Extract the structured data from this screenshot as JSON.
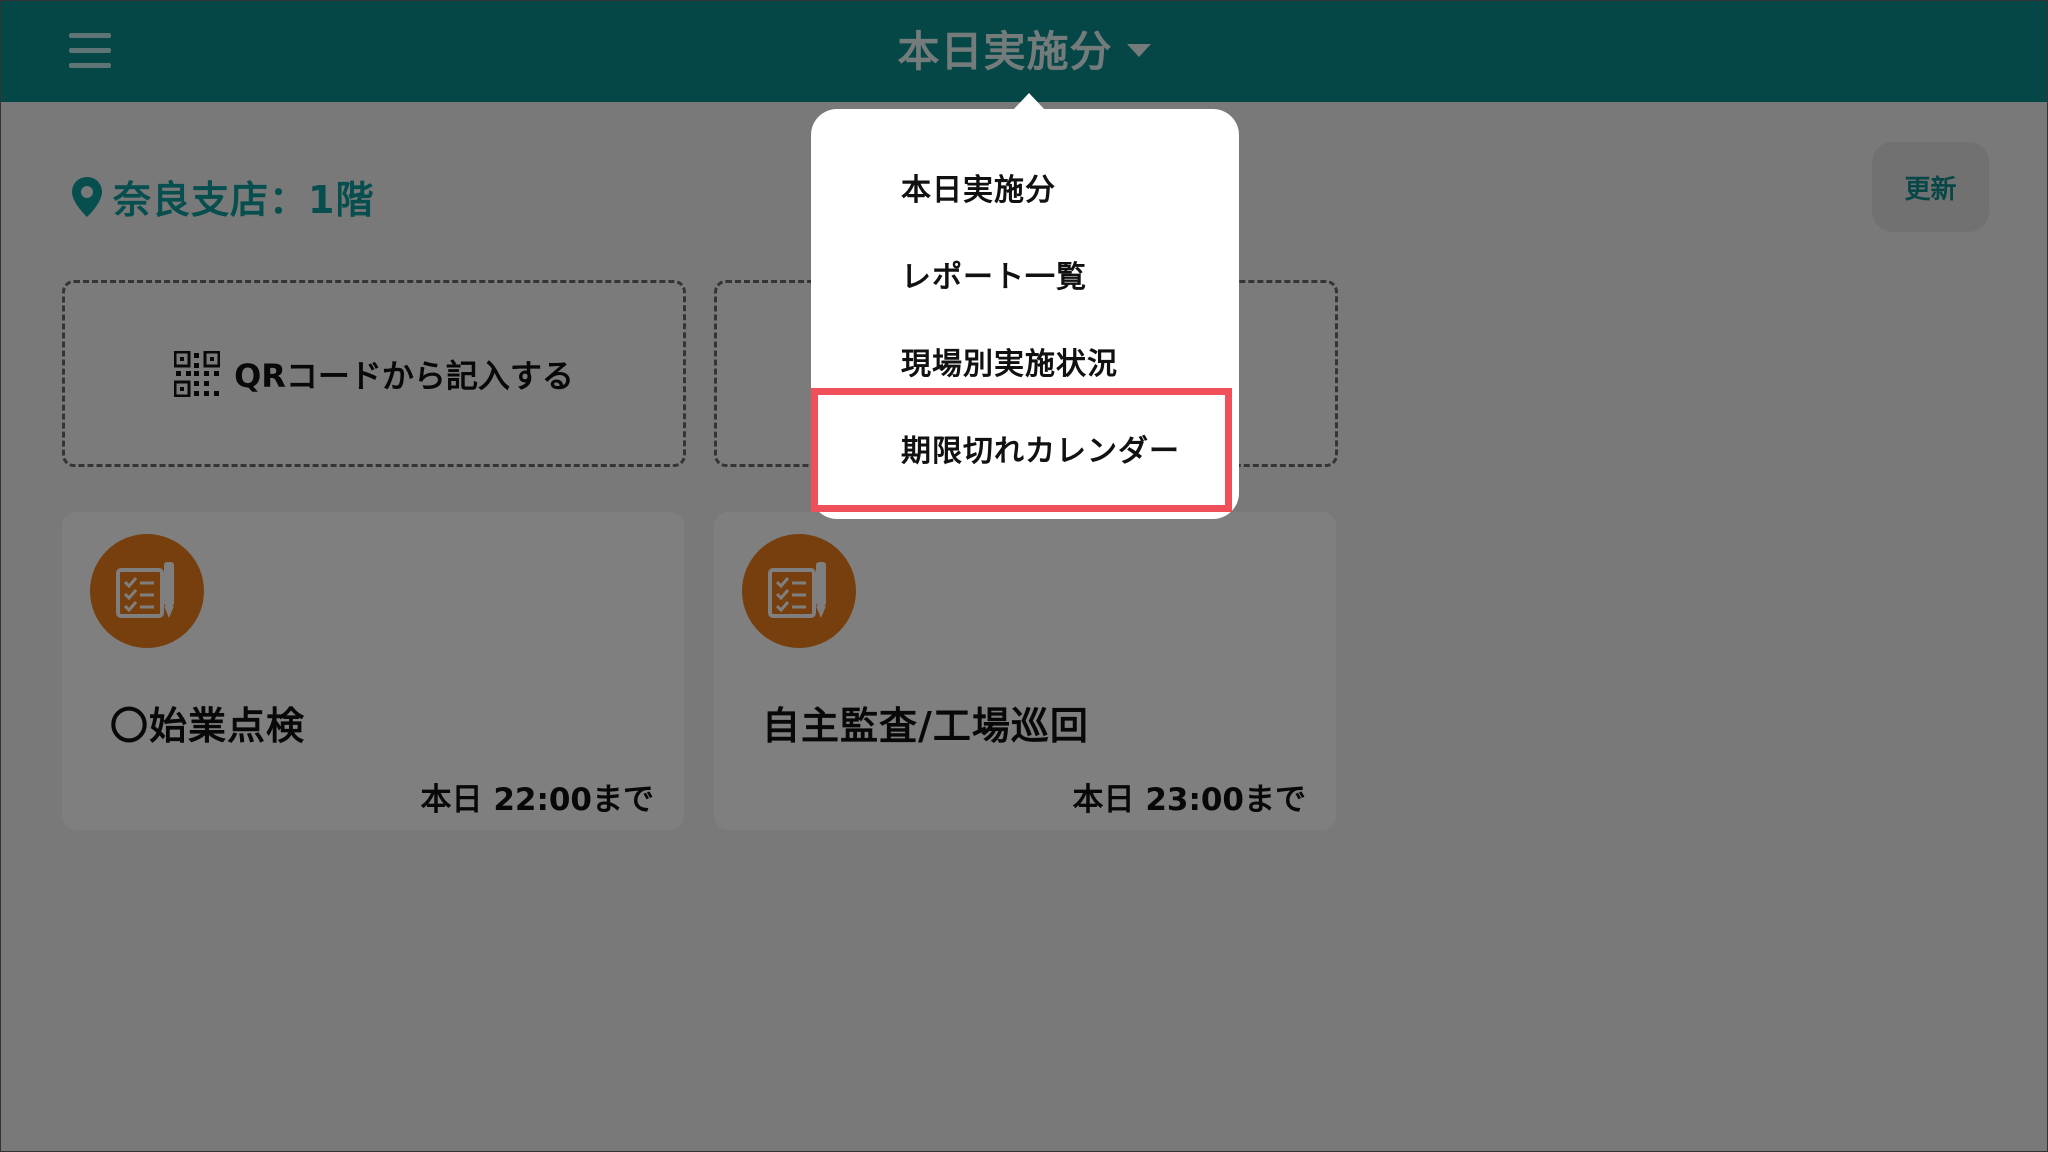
{
  "header": {
    "title": "本日実施分"
  },
  "location": {
    "text": "奈良支店：1階"
  },
  "actions": {
    "refresh_label": "更新",
    "qr_label": "QRコードから記入する"
  },
  "cards": [
    {
      "title": "〇始業点検",
      "deadline": "本日 22:00まで"
    },
    {
      "title": "自主監査/工場巡回",
      "deadline": "本日 23:00まで"
    }
  ],
  "dropdown": {
    "items": [
      "本日実施分",
      "レポート一覧",
      "現場別実施状況",
      "期限切れカレンダー"
    ],
    "highlighted_index": 3
  },
  "colors": {
    "header": "#0b8f8f",
    "accent_teal": "#0e9c9c",
    "card_icon": "#ef7f1a",
    "highlight_border": "#f0505a"
  }
}
